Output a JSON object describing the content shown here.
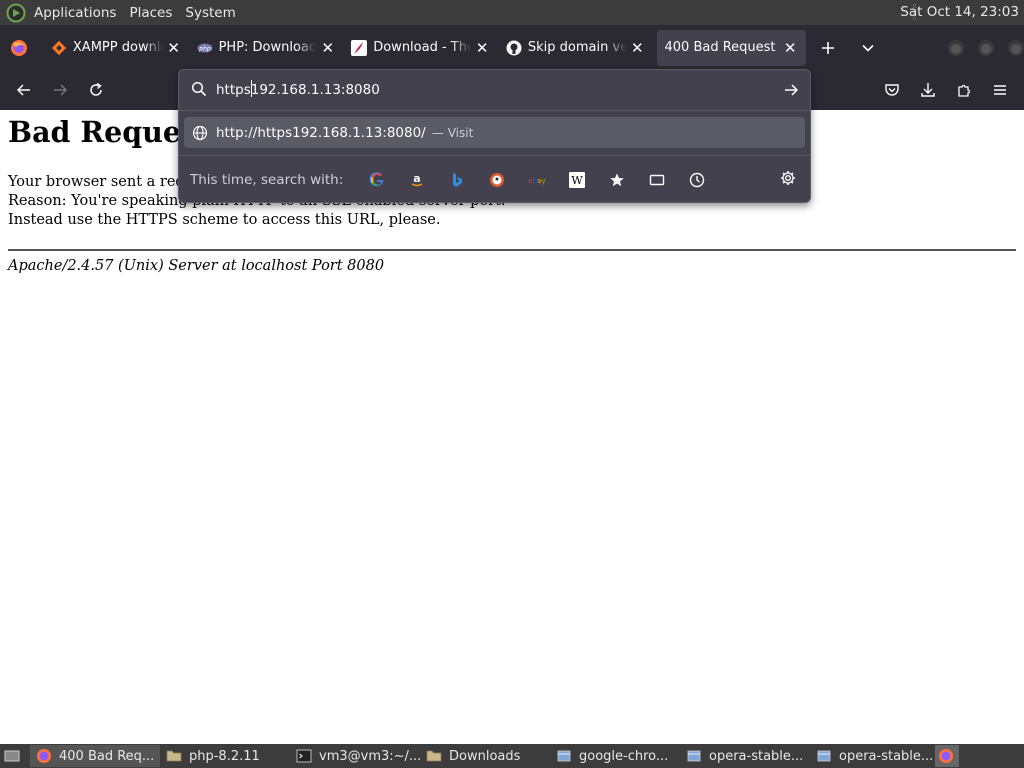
{
  "top_panel": {
    "menus": [
      "Applications",
      "Places",
      "System"
    ],
    "clock": "Sat Oct 14, 23:03"
  },
  "tabs": [
    {
      "title": "XAMPP downloa",
      "icon": "xampp-icon",
      "active": false
    },
    {
      "title": "PHP: Downloads",
      "icon": "php-icon",
      "active": false
    },
    {
      "title": "Download - The",
      "icon": "apache-feather-icon",
      "active": false
    },
    {
      "title": "Skip domain veri",
      "icon": "github-icon",
      "active": false
    },
    {
      "title": "400 Bad Request",
      "icon": "",
      "active": true
    }
  ],
  "urlbar": {
    "value": "https192.168.1.13:8080",
    "result_url": "http://https192.168.1.13:8080/",
    "result_separator": "—",
    "result_action": "Visit",
    "oneoff_label": "This time, search with:",
    "engines": [
      "google-icon",
      "amazon-icon",
      "bing-icon",
      "duckduckgo-icon",
      "ebay-icon",
      "wikipedia-icon",
      "bookmarks-icon",
      "tabs-icon",
      "history-icon"
    ]
  },
  "page": {
    "heading": "Bad Request",
    "line1": "Your browser sent a request that this server could not understand.",
    "line2": "Reason: You're speaking plain HTTP to an SSL-enabled server port.",
    "line3": "Instead use the HTTPS scheme to access this URL, please.",
    "address": "Apache/2.4.57 (Unix) Server at localhost Port 8080"
  },
  "taskbar": [
    {
      "label": "400 Bad Req...",
      "icon": "firefox-icon",
      "active": true
    },
    {
      "label": "php-8.2.11",
      "icon": "folder-icon",
      "active": false
    },
    {
      "label": "vm3@vm3:~/...",
      "icon": "terminal-icon",
      "active": false
    },
    {
      "label": "Downloads",
      "icon": "folder-icon",
      "active": false
    },
    {
      "label": "google-chro...",
      "icon": "package-icon",
      "active": false
    },
    {
      "label": "opera-stable...",
      "icon": "package-icon",
      "active": false
    },
    {
      "label": "opera-stable...",
      "icon": "package-icon",
      "active": false
    }
  ],
  "colors": {
    "chrome_dark": "#2b2a33",
    "tab_active": "#42414d",
    "panel": "#3c3c3c"
  }
}
